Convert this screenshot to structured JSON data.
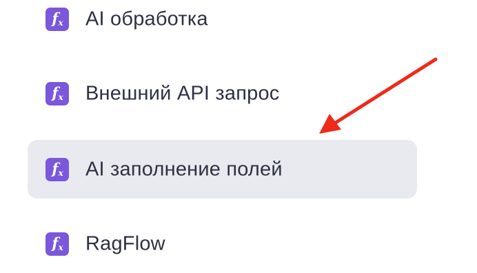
{
  "menu": {
    "items": [
      {
        "label": "AI обработка",
        "icon": "fx-icon",
        "icon_text_main": "f",
        "icon_text_sub": "x",
        "active": false
      },
      {
        "label": "Внешний API запрос",
        "icon": "fx-icon",
        "icon_text_main": "f",
        "icon_text_sub": "x",
        "active": false
      },
      {
        "label": "AI заполнение полей",
        "icon": "fx-icon",
        "icon_text_main": "f",
        "icon_text_sub": "x",
        "active": true
      },
      {
        "label": "RagFlow",
        "icon": "fx-icon",
        "icon_text_main": "f",
        "icon_text_sub": "x",
        "active": false
      }
    ]
  },
  "colors": {
    "icon_bg": "#7a57db",
    "active_bg": "#e9eaef",
    "text": "#2d3142",
    "arrow": "#ee2a1b"
  },
  "annotation": {
    "icon": "red-arrow-icon"
  }
}
